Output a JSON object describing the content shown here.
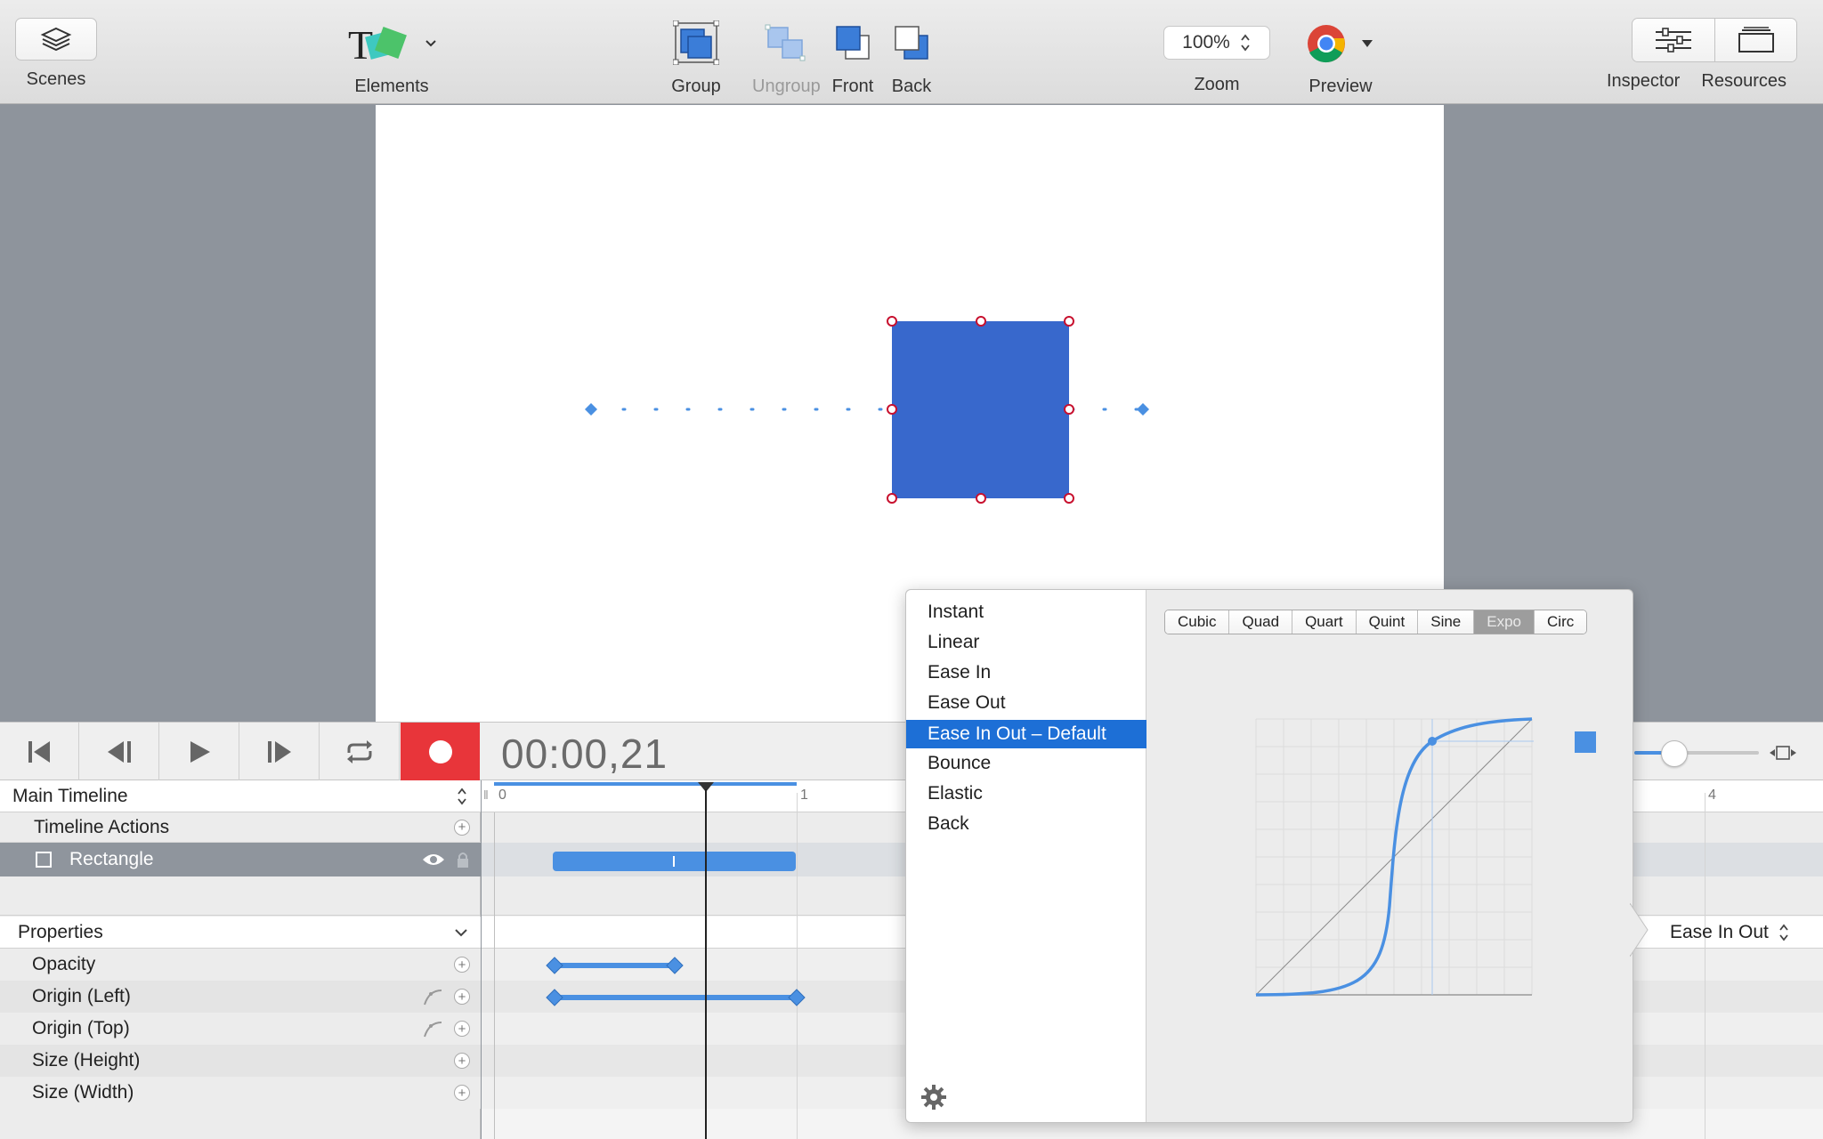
{
  "toolbar": {
    "scenes": "Scenes",
    "elements": "Elements",
    "group": "Group",
    "ungroup": "Ungroup",
    "front": "Front",
    "back": "Back",
    "zoom_value": "100%",
    "zoom": "Zoom",
    "preview": "Preview",
    "inspector": "Inspector",
    "resources": "Resources"
  },
  "transport": {
    "timecode": "00:00,21"
  },
  "timeline": {
    "main_timeline": "Main Timeline",
    "timeline_actions": "Timeline Actions",
    "element_name": "Rectangle",
    "properties_header": "Properties",
    "properties": [
      "Opacity",
      "Origin (Left)",
      "Origin (Top)",
      "Size (Height)",
      "Size (Width)"
    ],
    "ruler_labels": [
      "0",
      "1",
      "4"
    ],
    "easing_value": "Ease In Out"
  },
  "easing_popover": {
    "items": [
      "Instant",
      "Linear",
      "Ease In",
      "Ease Out",
      "Ease In Out – Default",
      "Bounce",
      "Elastic",
      "Back"
    ],
    "selected": "Ease In Out – Default",
    "tabs": [
      "Cubic",
      "Quad",
      "Quart",
      "Quint",
      "Sine",
      "Expo",
      "Circ"
    ],
    "active_tab": "Expo"
  },
  "colors": {
    "accent": "#1d6fd6",
    "shape_fill": "#3868cc",
    "record": "#e8353a",
    "keyframe": "#4a90e2"
  },
  "icons": [
    "layers-icon",
    "elements-icon",
    "group-icon",
    "ungroup-icon",
    "front-icon",
    "back-icon",
    "chrome-icon",
    "inspector-icon",
    "resources-icon",
    "skip-start-icon",
    "step-back-icon",
    "play-icon",
    "step-forward-icon",
    "loop-icon",
    "record-icon",
    "gear-icon"
  ]
}
